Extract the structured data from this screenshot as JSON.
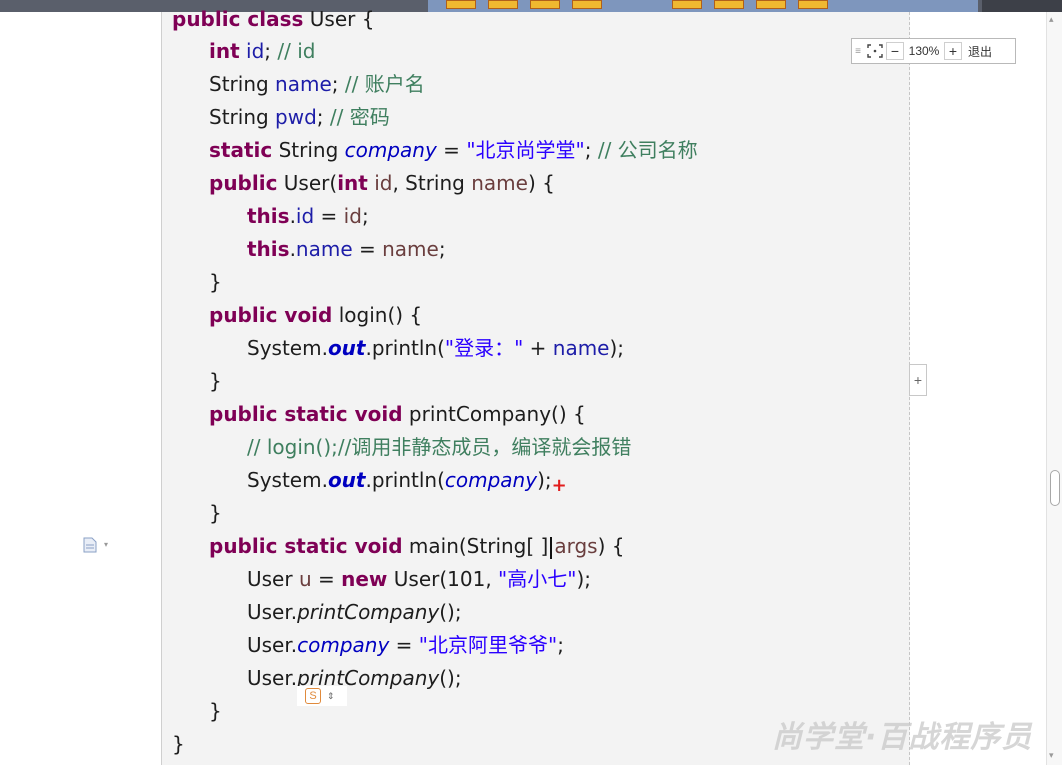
{
  "zoom": {
    "handle_icon": "drag-handle-icon",
    "fit_icon": "fit-screen-icon",
    "minus_label": "−",
    "percent": "130%",
    "plus_label": "+",
    "exit_label": "退出"
  },
  "side_plus_label": "+",
  "code": {
    "class_decl": {
      "kw": "public class",
      "name": " User {"
    },
    "f_id": {
      "kw": "int",
      "var": " id",
      "rest": "; ",
      "comment": "// id"
    },
    "f_name": {
      "type": "String",
      "var": " name",
      "rest": "; ",
      "comment": "// 账户名"
    },
    "f_pwd": {
      "type": "String",
      "var": " pwd",
      "rest": "; ",
      "comment": "// 密码"
    },
    "f_company": {
      "kw": "static",
      "type": " String ",
      "var": "company",
      "eq": " = ",
      "str": "\"北京尚学堂\"",
      "rest": "; ",
      "comment": "// 公司名称"
    },
    "ctor": {
      "kw": "public",
      "a": " User(",
      "kw2": "int",
      "p1": " id",
      "b": ", String ",
      "p2": "name",
      "c": ") {"
    },
    "ctor_b1": {
      "kw": "this",
      "dot": ".",
      "var": "id",
      "eq": " = ",
      "p": "id",
      "end": ";"
    },
    "ctor_b2": {
      "kw": "this",
      "dot": ".",
      "var": "name",
      "eq": " = ",
      "p": "name",
      "end": ";"
    },
    "close1": "}",
    "login": {
      "kw": "public void",
      "rest": " login() {"
    },
    "login_b": {
      "a": "System.",
      "out": "out",
      "b": ".println(",
      "str": "\"登录：\"",
      "c": " + ",
      "var": "name",
      "d": ");"
    },
    "close2": "}",
    "pc": {
      "kw": "public static void",
      "rest": " printCompany() {"
    },
    "pc_c": "// login();//调用非静态成员，编译就会报错",
    "pc_b": {
      "a": "System.",
      "out": "out",
      "b": ".println(",
      "var": "company",
      "c": ");",
      "mark": "+"
    },
    "close3": "}",
    "main": {
      "kw": "public static void",
      "a": " main(String[ ]",
      "p": "args",
      "b": ") {"
    },
    "m1": {
      "a": "User ",
      "p": "u",
      "b": " = ",
      "kw": "new",
      "c": " User(101, ",
      "str": "\"高小七\"",
      "d": ");"
    },
    "m2": {
      "a": "User.",
      "mi": "printCompany",
      "b": "();"
    },
    "m3": {
      "a": "User.",
      "st": "company",
      "b": " = ",
      "str": "\"北京阿里爷爷\"",
      "c": ";"
    },
    "m4": {
      "a": "User.",
      "mi": "printCompany",
      "b": "();"
    },
    "close4": "}",
    "close5": "}"
  },
  "watermark": "尚学堂·百战程序员",
  "icons": {
    "doc": "document-icon",
    "snippet": "snippet-badge-icon",
    "scroll_up": "scroll-up-icon",
    "scroll_down": "scroll-down-icon"
  }
}
